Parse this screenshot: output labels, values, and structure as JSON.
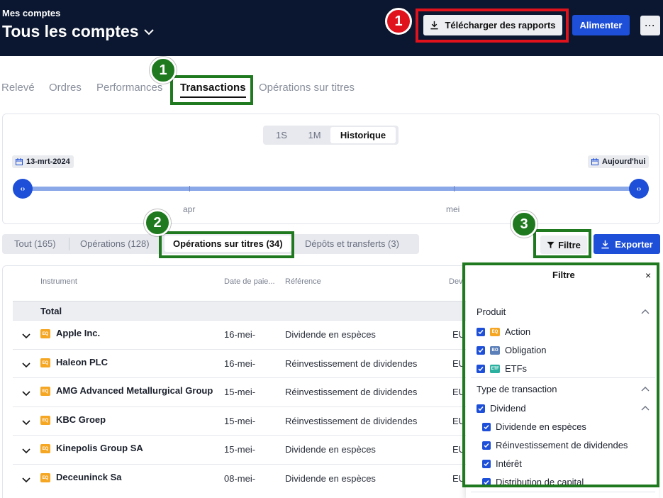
{
  "header": {
    "overline": "Mes comptes",
    "title": "Tous les comptes",
    "download_label": "Télécharger des rapports",
    "fund_label": "Alimenter",
    "more_label": "···"
  },
  "main_tabs": [
    {
      "label": "Relevé",
      "active": false
    },
    {
      "label": "Ordres",
      "active": false
    },
    {
      "label": "Performances",
      "active": false
    },
    {
      "label": "Transactions",
      "active": true
    },
    {
      "label": "Opérations sur titres",
      "active": false
    }
  ],
  "period": {
    "options": [
      {
        "label": "1S",
        "active": false
      },
      {
        "label": "1M",
        "active": false
      },
      {
        "label": "Historique",
        "active": true
      }
    ],
    "start_date": "13-mrt-2024",
    "end_date": "Aujourd'hui",
    "handle_glyph": "‹›",
    "months": [
      "apr",
      "mei"
    ]
  },
  "sub_tabs": [
    {
      "label": "Tout (165)",
      "active": false
    },
    {
      "label": "Opérations (128)",
      "active": false
    },
    {
      "label": "Opérations sur titres (34)",
      "active": true
    },
    {
      "label": "Dépôts et transferts (3)",
      "active": false
    }
  ],
  "actions": {
    "filter_label": "Filtre",
    "export_label": "Exporter"
  },
  "table": {
    "columns": {
      "instrument": "Instrument",
      "payment_date": "Date de paie...",
      "reference": "Référence",
      "currency": "Dev"
    },
    "total_label": "Total",
    "badge": "EQ",
    "rows": [
      {
        "name": "Apple Inc.",
        "date": "16-mei-",
        "reference": "Dividende en espèces",
        "currency": "EU"
      },
      {
        "name": "Haleon PLC",
        "date": "16-mei-",
        "reference": "Réinvestissement de dividendes",
        "currency": "EU"
      },
      {
        "name": "AMG Advanced Metallurgical Group",
        "date": "15-mei-",
        "reference": "Réinvestissement de dividendes",
        "currency": "EU"
      },
      {
        "name": "KBC Groep",
        "date": "15-mei-",
        "reference": "Réinvestissement de dividendes",
        "currency": "EU"
      },
      {
        "name": "Kinepolis Group SA",
        "date": "15-mei-",
        "reference": "Dividende en espèces",
        "currency": "EU"
      },
      {
        "name": "Deceuninck Sa",
        "date": "08-mei-",
        "reference": "Dividende en espèces",
        "currency": "EU"
      }
    ]
  },
  "filter_panel": {
    "title": "Filtre",
    "close_glyph": "×",
    "product_section": "Produit",
    "products": [
      {
        "badge": "EQ",
        "label": "Action",
        "checked": true,
        "color": "#f5a623"
      },
      {
        "badge": "BO",
        "label": "Obligation",
        "checked": true,
        "color": "#5b7fb8"
      },
      {
        "badge": "ETF",
        "label": "ETFs",
        "checked": true,
        "color": "#2bb0a0"
      }
    ],
    "type_section": "Type de transaction",
    "dividend_label": "Dividend",
    "dividend_items": [
      {
        "label": "Dividende en espèces",
        "checked": true
      },
      {
        "label": "Réinvestissement de dividendes",
        "checked": true
      },
      {
        "label": "Intérêt",
        "checked": true
      },
      {
        "label": "Distribution de capital",
        "checked": true
      }
    ]
  },
  "annotations": [
    {
      "number": "1",
      "color": "#e0121b"
    },
    {
      "number": "1",
      "color": "#1f7a1f"
    },
    {
      "number": "2",
      "color": "#1f7a1f"
    },
    {
      "number": "3",
      "color": "#1f7a1f"
    }
  ]
}
